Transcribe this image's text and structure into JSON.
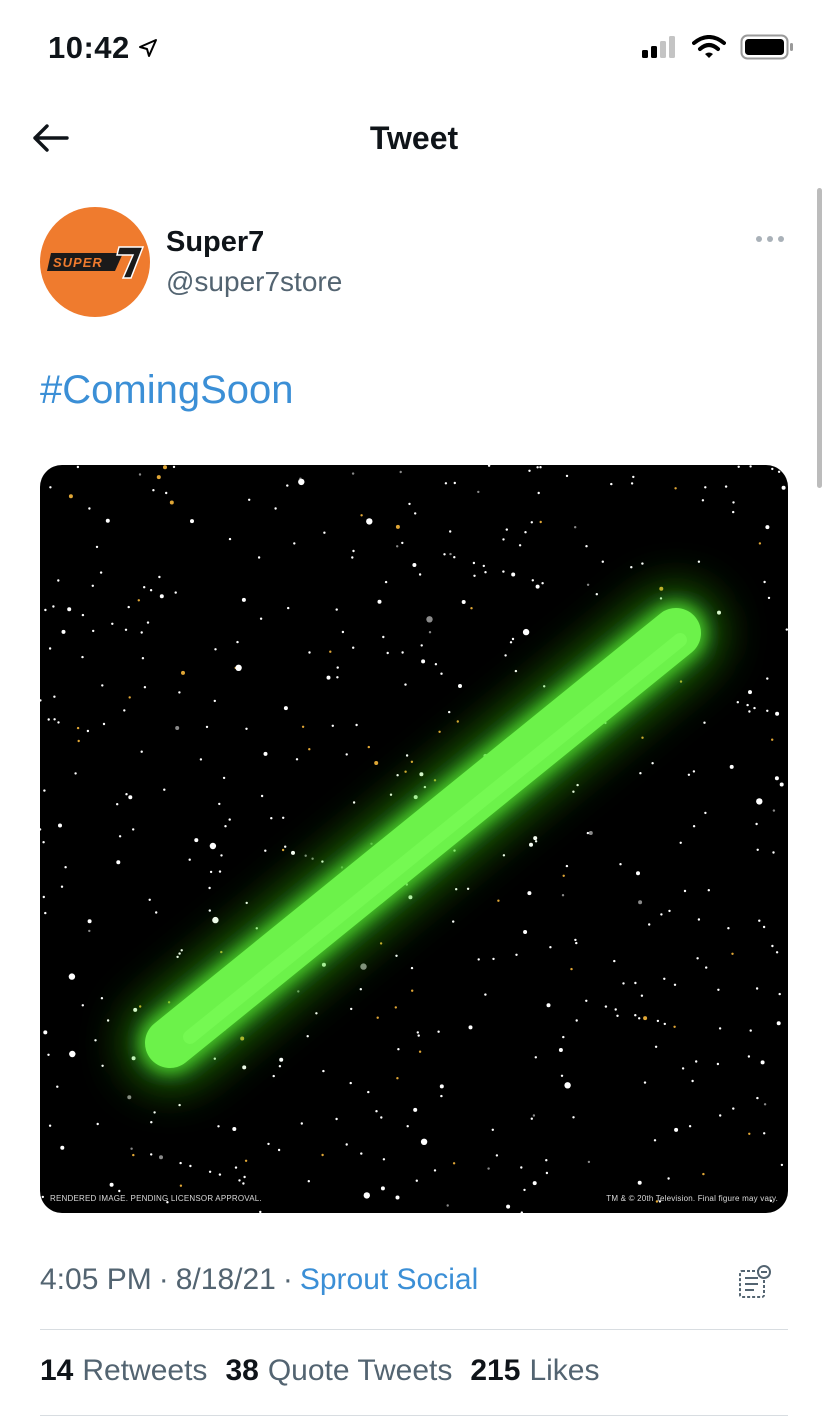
{
  "status_bar": {
    "time": "10:42"
  },
  "nav": {
    "title": "Tweet"
  },
  "tweet": {
    "author_name": "Super7",
    "author_handle": "@super7store",
    "avatar_text": "SUPER7",
    "text": "#ComingSoon",
    "media": {
      "caption_left": "RENDERED IMAGE. PENDING LICENSOR APPROVAL.",
      "caption_right": "TM & © 20th Television. Final figure may vary."
    },
    "time": "4:05 PM",
    "date": "8/18/21",
    "separator": "·",
    "source": "Sprout Social"
  },
  "stats": {
    "retweets_count": "14",
    "retweets_label": "Retweets",
    "quotes_count": "38",
    "quotes_label": "Quote Tweets",
    "likes_count": "215",
    "likes_label": "Likes"
  },
  "colors": {
    "link": "#3b8fd6",
    "avatar_bg": "#ef7b2e",
    "saber": "#6cf24a"
  }
}
